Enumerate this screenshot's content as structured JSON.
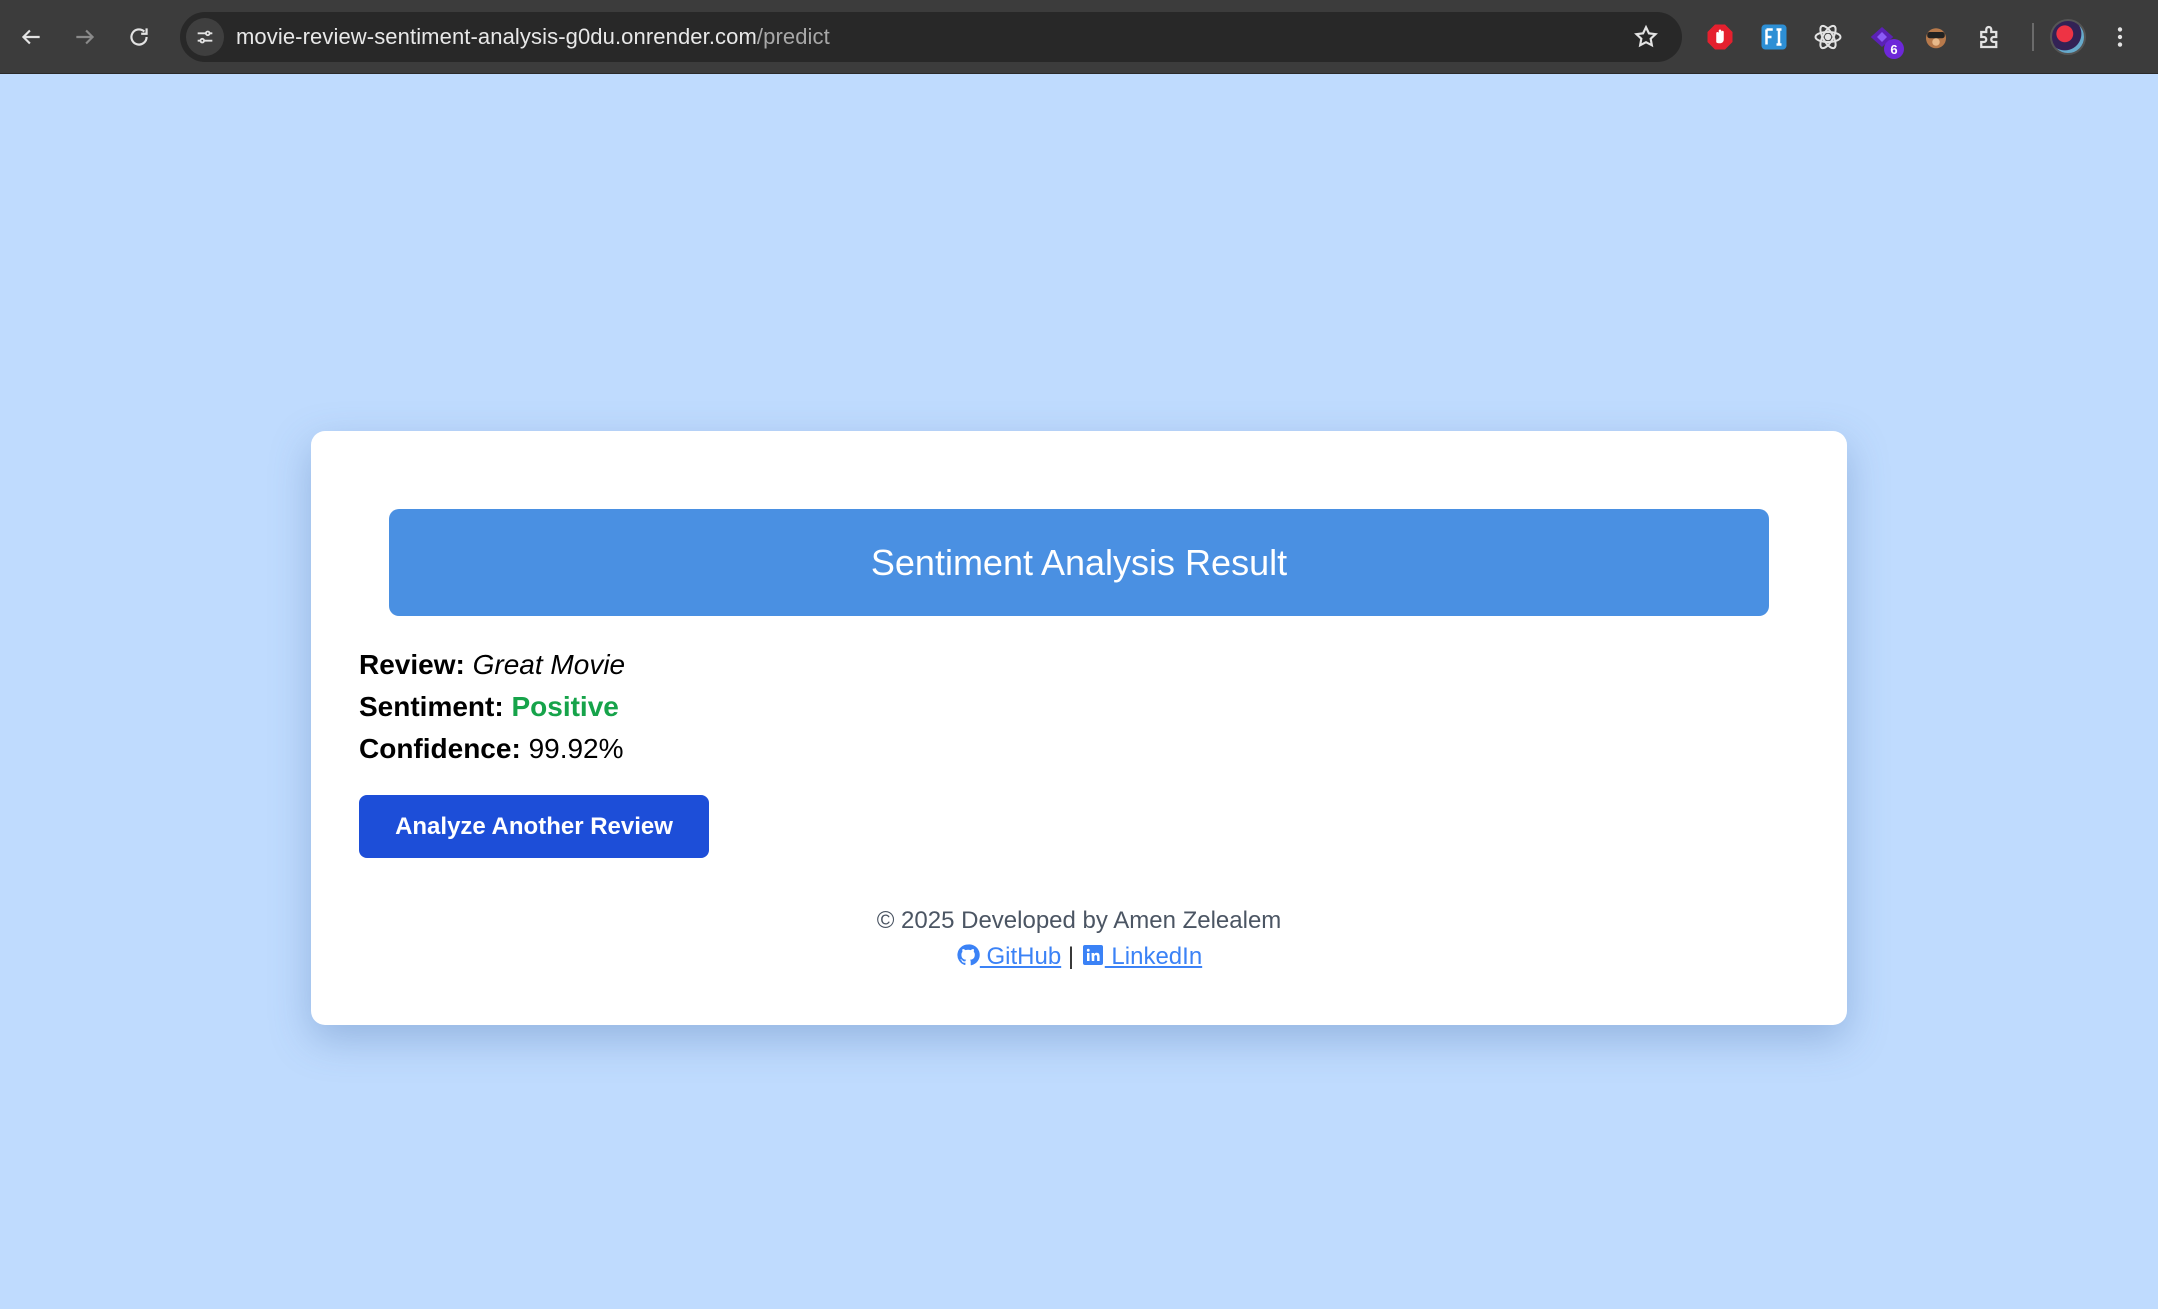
{
  "browser": {
    "url_host": "movie-review-sentiment-analysis-g0du.onrender.com",
    "url_path": "/predict",
    "extensions": [
      {
        "name": "adblock-icon"
      },
      {
        "name": "fi-extension-icon"
      },
      {
        "name": "react-devtools-icon"
      },
      {
        "name": "purple-extension-icon",
        "badge": "6"
      },
      {
        "name": "monkey-extension-icon"
      },
      {
        "name": "extensions-puzzle-icon"
      }
    ]
  },
  "result": {
    "title": "Sentiment Analysis Result",
    "review_label": "Review:",
    "review_value": "Great Movie",
    "sentiment_label": "Sentiment:",
    "sentiment_value": "Positive",
    "confidence_label": "Confidence:",
    "confidence_value": "99.92%",
    "button_label": "Analyze Another Review"
  },
  "footer": {
    "credit": "© 2025 Developed by Amen Zelealem",
    "github_label": " GitHub",
    "separator": "|",
    "linkedin_label": " LinkedIn"
  },
  "colors": {
    "page_background": "#bfdbfe",
    "header_blue": "#4a90e2",
    "button_blue": "#1d4ed8",
    "positive_green": "#16a34a",
    "link_blue": "#3b82f6"
  }
}
